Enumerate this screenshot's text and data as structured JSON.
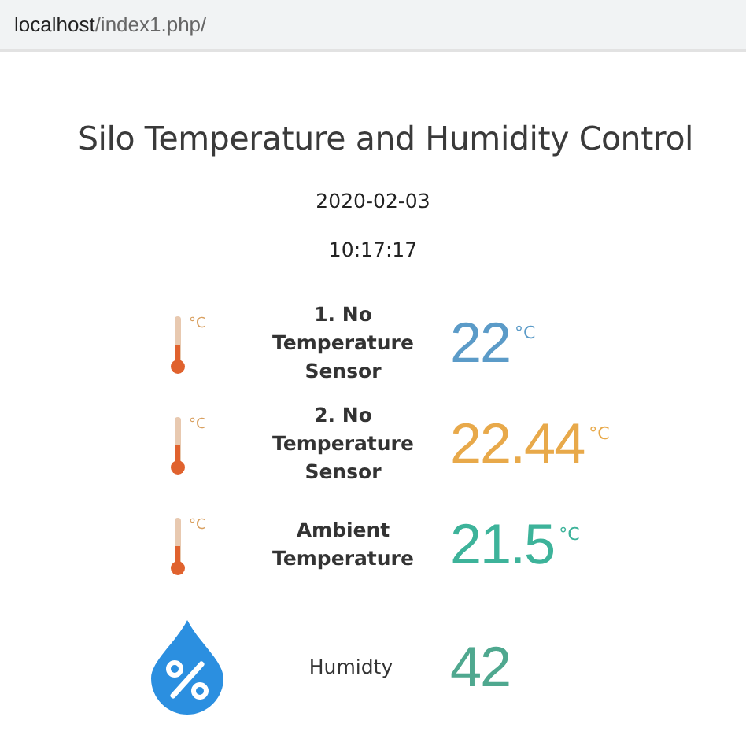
{
  "address_bar": {
    "host": "localhost",
    "path": "/index1.php/"
  },
  "title": "Silo Temperature and Humidity Control",
  "date": "2020-02-03",
  "time": "10:17:17",
  "readings": [
    {
      "kind": "temperature",
      "icon_unit": "°C",
      "label": "1. No Temperature Sensor",
      "value": "22",
      "unit": "°C",
      "color": "#5b9bc8"
    },
    {
      "kind": "temperature",
      "icon_unit": "°C",
      "label": "2. No Temperature Sensor",
      "value": "22.44",
      "unit": "°C",
      "color": "#e8a94a"
    },
    {
      "kind": "temperature",
      "icon_unit": "°C",
      "label": "Ambient Temperature",
      "value": "21.5",
      "unit": "°C",
      "color": "#3db39a"
    },
    {
      "kind": "humidity",
      "label": "Humidty",
      "value": "42",
      "color": "#4fa88f"
    }
  ]
}
